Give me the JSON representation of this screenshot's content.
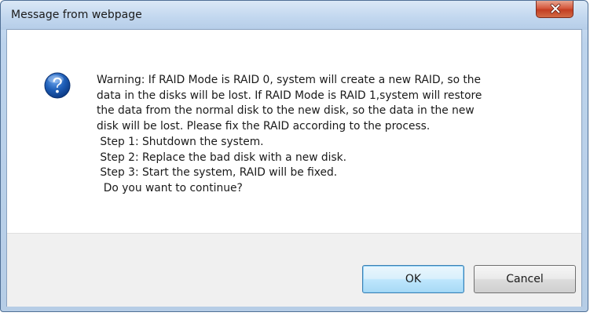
{
  "window": {
    "title": "Message from webpage",
    "close_label": "X"
  },
  "dialog": {
    "icon": "question-icon",
    "message_lines": [
      "Warning: If RAID Mode is RAID 0, system will create a new RAID, so the",
      "data in the disks will be lost. If RAID Mode is RAID 1,system will restore",
      "the data from the normal disk to the new disk, so the data in the new",
      "disk will be lost. Please fix the RAID according to the process.",
      " Step 1: Shutdown the system.",
      " Step 2: Replace the bad disk with a new disk.",
      " Step 3: Start the system, RAID will be fixed.",
      "  Do you want to continue?"
    ]
  },
  "buttons": {
    "ok_label": "OK",
    "cancel_label": "Cancel"
  },
  "colors": {
    "titlebar": "#c3d8ef",
    "close_button": "#c33e22",
    "question_icon": "#1f5fb8",
    "button_area": "#f0f0f0",
    "default_button_border": "#3c7fb1"
  }
}
